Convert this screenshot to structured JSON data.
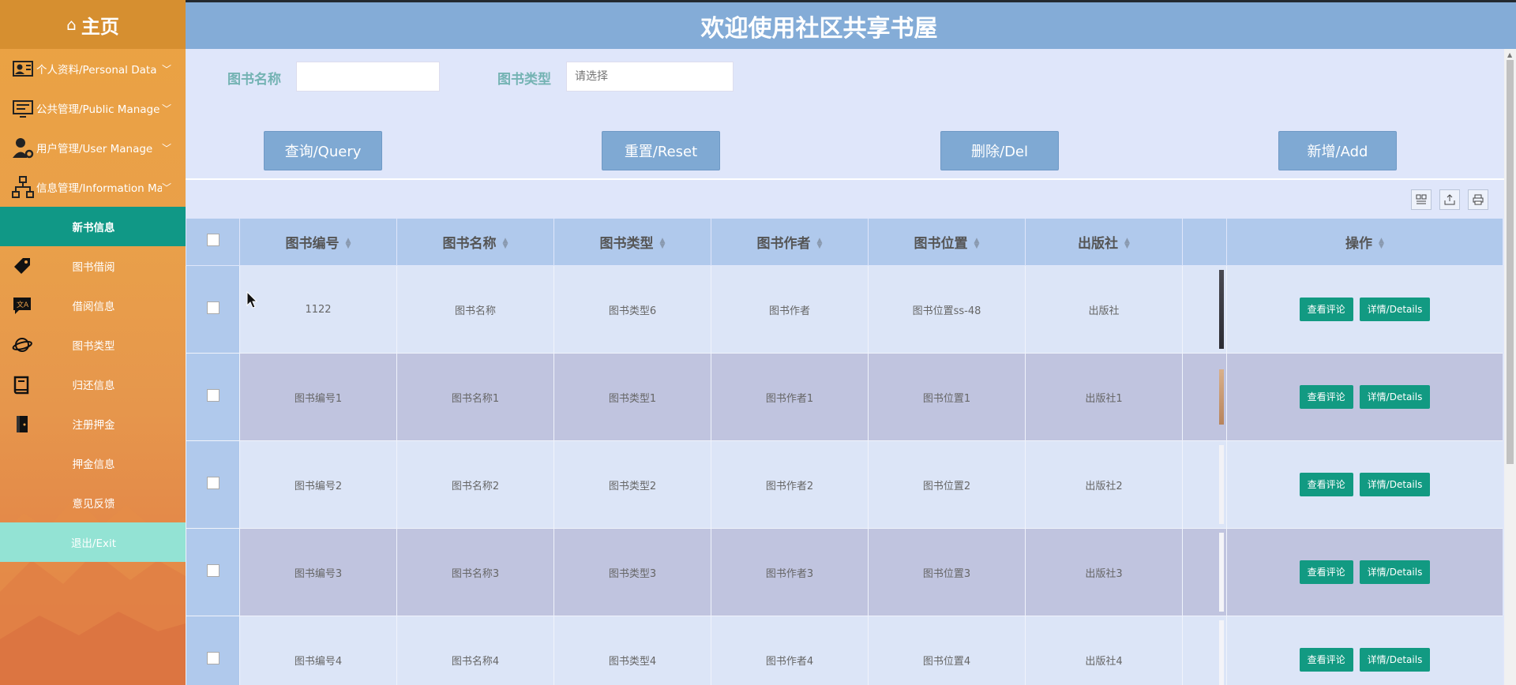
{
  "sidebar": {
    "home_label": "主页",
    "groups": [
      {
        "label": "个人资料/Personal Data"
      },
      {
        "label": "公共管理/Public Manage"
      },
      {
        "label": "用户管理/User Manage"
      },
      {
        "label": "信息管理/Information Manage"
      }
    ],
    "items": [
      {
        "label": "新书信息",
        "icon": "none",
        "active": true
      },
      {
        "label": "图书借阅",
        "icon": "tag-icon"
      },
      {
        "label": "借阅信息",
        "icon": "message-icon"
      },
      {
        "label": "图书类型",
        "icon": "planet-icon"
      },
      {
        "label": "归还信息",
        "icon": "book-icon"
      },
      {
        "label": "注册押金",
        "icon": "door-icon"
      },
      {
        "label": "押金信息",
        "icon": "none"
      },
      {
        "label": "意见反馈",
        "icon": "none"
      }
    ],
    "exit_label": "退出/Exit"
  },
  "header": {
    "title": "欢迎使用社区共享书屋"
  },
  "search": {
    "name_label": "图书名称",
    "name_value": "",
    "type_label": "图书类型",
    "type_placeholder": "请选择",
    "buttons": {
      "query": "查询/Query",
      "reset": "重置/Reset",
      "delete": "删除/Del",
      "add": "新增/Add"
    }
  },
  "table": {
    "columns": [
      "图书编号",
      "图书名称",
      "图书类型",
      "图书作者",
      "图书位置",
      "出版社",
      "",
      "操作"
    ],
    "rows": [
      {
        "id": "1122",
        "name": "图书名称",
        "type": "图书类型6",
        "author": "图书作者",
        "location": "图书位置ss-48",
        "publisher": "出版社"
      },
      {
        "id": "图书编号1",
        "name": "图书名称1",
        "type": "图书类型1",
        "author": "图书作者1",
        "location": "图书位置1",
        "publisher": "出版社1"
      },
      {
        "id": "图书编号2",
        "name": "图书名称2",
        "type": "图书类型2",
        "author": "图书作者2",
        "location": "图书位置2",
        "publisher": "出版社2"
      },
      {
        "id": "图书编号3",
        "name": "图书名称3",
        "type": "图书类型3",
        "author": "图书作者3",
        "location": "图书位置3",
        "publisher": "出版社3"
      },
      {
        "id": "图书编号4",
        "name": "图书名称4",
        "type": "图书类型4",
        "author": "图书作者4",
        "location": "图书位置4",
        "publisher": "出版社4"
      }
    ],
    "actions": {
      "comment": "查看评论",
      "details": "详情/Details"
    }
  },
  "colors": {
    "sidebar_top": "#eba242",
    "header_bg": "#84acd7",
    "active_item": "#109886",
    "exit_item": "#93e3d4",
    "button_bg": "#7fa9d3",
    "action_btn": "#129a82",
    "row_odd": "#dce5f7",
    "row_even": "#c0c4df"
  }
}
